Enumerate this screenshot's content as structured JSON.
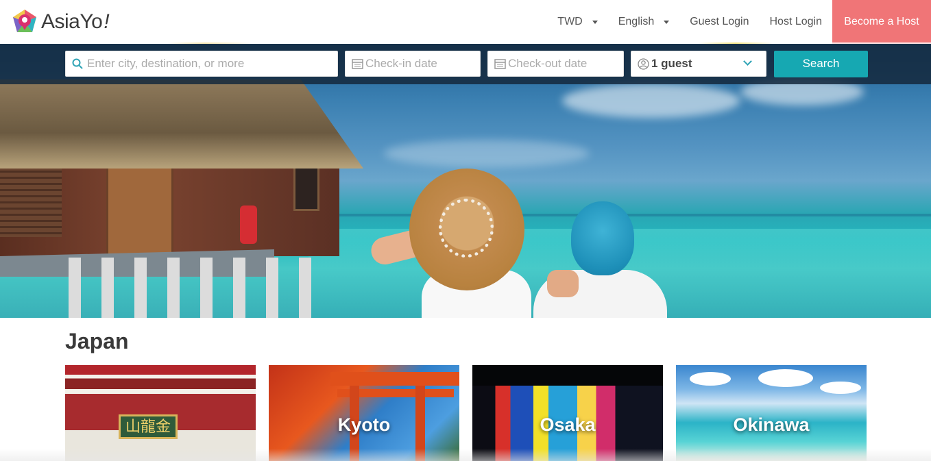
{
  "brand": {
    "name": "AsiaYo",
    "slash": "!"
  },
  "nav": {
    "currency": "TWD",
    "language": "English",
    "guest_login": "Guest Login",
    "host_login": "Host Login",
    "become_host": "Become a Host"
  },
  "search": {
    "destination_placeholder": "Enter city, destination, or more",
    "checkin_placeholder": "Check-in date",
    "checkout_placeholder": "Check-out date",
    "guests_value": "1 guest",
    "button_label": "Search",
    "icons": {
      "destination": "search-icon",
      "checkin": "calendar-icon",
      "checkout": "calendar-icon",
      "guests": "user-icon",
      "guests_toggle": "chevron-down-icon"
    }
  },
  "section": {
    "title": "Japan",
    "cards": [
      {
        "label": ""
      },
      {
        "label": "Kyoto"
      },
      {
        "label": "Osaka"
      },
      {
        "label": "Okinawa"
      }
    ]
  },
  "colors": {
    "accent": "#16a8b2",
    "host_button": "#f07577",
    "search_bg": "#142838"
  }
}
